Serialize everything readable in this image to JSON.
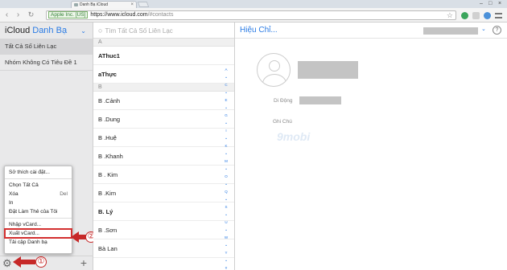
{
  "browser": {
    "tab_title": "Danh Bạ iCloud",
    "tab_close": "×",
    "window_controls": [
      "–",
      "□",
      "×"
    ],
    "nav": {
      "back": "‹",
      "forward": "›",
      "reload": "↻"
    },
    "secure_label": "Apple Inc. [US]",
    "url_host": "https://www.icloud.com",
    "url_path": "/#contacts",
    "star": "☆"
  },
  "sidebar": {
    "brand": "iCloud",
    "app_name": "Danh Bạ",
    "chevron": "⌄",
    "groups": [
      "Tất Cả Số Liên Lạc",
      "Nhóm Không Có Tiêu Đề 1"
    ],
    "gear": "⚙",
    "plus": "+"
  },
  "menu": {
    "items": [
      {
        "label": "Sở thích cài đặt..."
      },
      {
        "label": "Chọn Tất Cả"
      },
      {
        "label": "Xóa",
        "shortcut": "Del"
      },
      {
        "label": "In"
      },
      {
        "label": "Đặt Làm Thẻ của Tôi"
      },
      {
        "label": "Nhập vCard..."
      },
      {
        "label": "Xuất vCard..."
      },
      {
        "label": "Tải cập Danh bạ"
      }
    ]
  },
  "annotations": {
    "marker1": "①",
    "marker2": "②"
  },
  "list": {
    "search_placeholder": "Tìm Tất Cả Số Liên Lạc",
    "sections": [
      {
        "letter": "A",
        "contacts": [
          "AThuc1",
          "aThực"
        ]
      },
      {
        "letter": "B",
        "contacts": [
          "B .Cảnh",
          "B .Dung",
          "B .Huệ",
          "B .Khanh",
          "B . Kim",
          "B .Kim",
          "B. Lý",
          "B .Sơn",
          "Bà Lan"
        ]
      }
    ],
    "index": [
      "A",
      "•",
      "C",
      "•",
      "E",
      "•",
      "G",
      "•",
      "I",
      "•",
      "K",
      "•",
      "M",
      "•",
      "O",
      "•",
      "Q",
      "•",
      "S",
      "•",
      "U",
      "•",
      "W",
      "•",
      "Y",
      "•",
      "#"
    ]
  },
  "detail": {
    "title": "Hiệu Chỉ...",
    "chevron": "⌄",
    "help": "?",
    "mobile_label": "Di Động",
    "notes_label": "Ghi Chú",
    "watermark": "9mobi"
  },
  "colors": {
    "accent": "#2a7be4",
    "annotation": "#c62828"
  }
}
